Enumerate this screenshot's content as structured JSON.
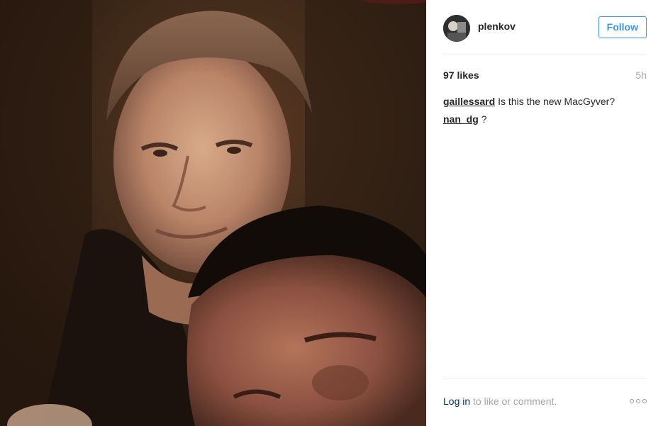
{
  "photo": {
    "icon": "photo"
  },
  "header": {
    "username": "plenkov",
    "follow_label": "Follow"
  },
  "stats": {
    "likes": "97 likes",
    "time": "5h"
  },
  "comments": [
    {
      "author": "gaillessard",
      "text": "Is this the new MacGyver?"
    },
    {
      "author": "nan_dg",
      "text": "?"
    }
  ],
  "footer": {
    "login_label": "Log in",
    "prompt_text": "to like or comment."
  },
  "colors": {
    "accent": "#3897f0",
    "link": "#003569",
    "muted": "#a5a7aa",
    "divider": "#efefef"
  }
}
